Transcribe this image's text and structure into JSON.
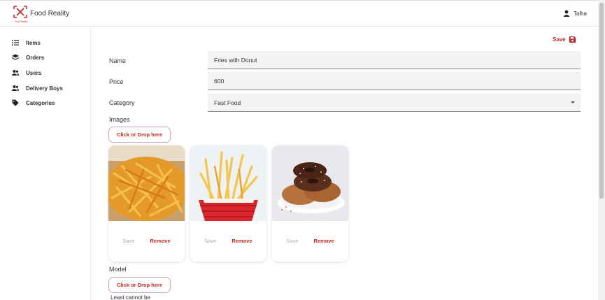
{
  "header": {
    "brand": "Food Reality",
    "brand_tagline": "Food Reality",
    "user": "Talha",
    "brand_color": "#c62828"
  },
  "sidebar": {
    "items": [
      {
        "label": "Items",
        "icon": "list-icon"
      },
      {
        "label": "Orders",
        "icon": "layers-icon"
      },
      {
        "label": "Users",
        "icon": "users-icon"
      },
      {
        "label": "Delivery Boys",
        "icon": "users-icon"
      },
      {
        "label": "Categories",
        "icon": "tag-icon"
      }
    ]
  },
  "form": {
    "save_label": "Save",
    "name_label": "Name",
    "name_value": "Fries with Donut",
    "price_label": "Price",
    "price_value": "600",
    "category_label": "Category",
    "category_value": "Fast Food",
    "images_label": "Images",
    "drop_label": "Click or Drop here",
    "model_label": "Model",
    "model_drop_label": "Click or Drop here",
    "bottom_text": "Least cannot be"
  },
  "images": [
    {
      "alt": "fries-photo",
      "save": "Save",
      "remove": "Remove"
    },
    {
      "alt": "fries-basket-photo",
      "save": "Save",
      "remove": "Remove"
    },
    {
      "alt": "donuts-photo",
      "save": "Save",
      "remove": "Remove"
    }
  ]
}
